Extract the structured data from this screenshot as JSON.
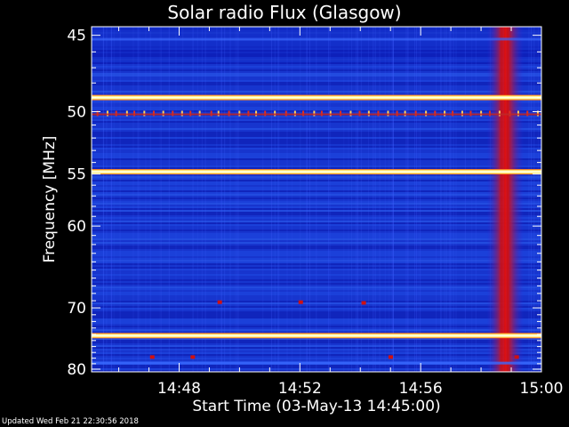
{
  "chart_data": {
    "type": "heatmap",
    "title": "Solar radio Flux (Glasgow)",
    "xlabel": "Start Time (03-May-13 14:45:00)",
    "ylabel": "Frequency [MHz]",
    "x_tick_labels": [
      "14:48",
      "14:52",
      "14:56",
      "15:00"
    ],
    "x_tick_minutes": [
      3,
      7,
      11,
      15
    ],
    "xlim_minutes": [
      0.1,
      15
    ],
    "y_tick_labels": [
      "45",
      "50",
      "55",
      "60",
      "70",
      "80"
    ],
    "y_tick_values": [
      45,
      50,
      55,
      60,
      70,
      80
    ],
    "ylim": [
      44.5,
      80.5
    ],
    "y_scale": "reciprocal",
    "grid": false,
    "colors": {
      "background_low": "#0a1ab8",
      "background_mid": "#1a3ad6",
      "interference": "#ffffc0",
      "burst": "#d01010"
    },
    "features": {
      "interference_bands_mhz": [
        49.0,
        54.8,
        74.2
      ],
      "burst_start_minute": 13.6,
      "burst_end_minute": 14.0,
      "burst_peak_minute": 13.8
    }
  },
  "footer": "Updated Wed Feb 21 22:30:56 2018"
}
